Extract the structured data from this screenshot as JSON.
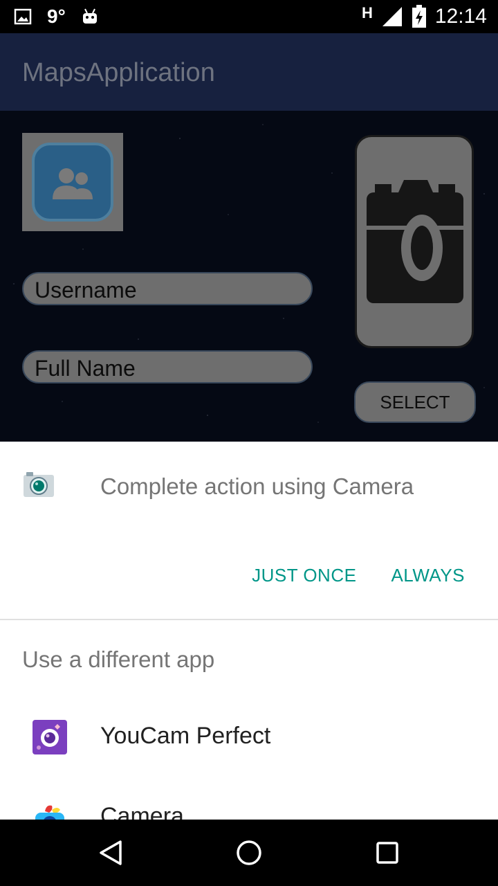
{
  "status_bar": {
    "temperature": "9°",
    "network": "H",
    "time": "12:14",
    "icons": [
      "image-icon",
      "android-icon",
      "signal-icon",
      "battery-charging-icon"
    ]
  },
  "app_bar": {
    "title": "MapsApplication"
  },
  "form": {
    "avatar_icon": "contacts-icon",
    "username_placeholder": "Username",
    "fullname_placeholder": "Full Name",
    "camera_icon": "camera-icon",
    "select_label": "SELECT"
  },
  "chooser": {
    "title": "Complete action using Camera",
    "title_icon": "camera-app-icon",
    "just_once_label": "JUST ONCE",
    "always_label": "ALWAYS",
    "subheader": "Use a different app",
    "apps": [
      {
        "label": "YouCam Perfect",
        "icon": "youcam-perfect-icon"
      },
      {
        "label": "Camera",
        "icon": "camera-app-icon"
      }
    ],
    "accent_color": "#009688"
  },
  "nav_bar": {
    "icons": [
      "back-icon",
      "home-icon",
      "recents-icon"
    ]
  }
}
